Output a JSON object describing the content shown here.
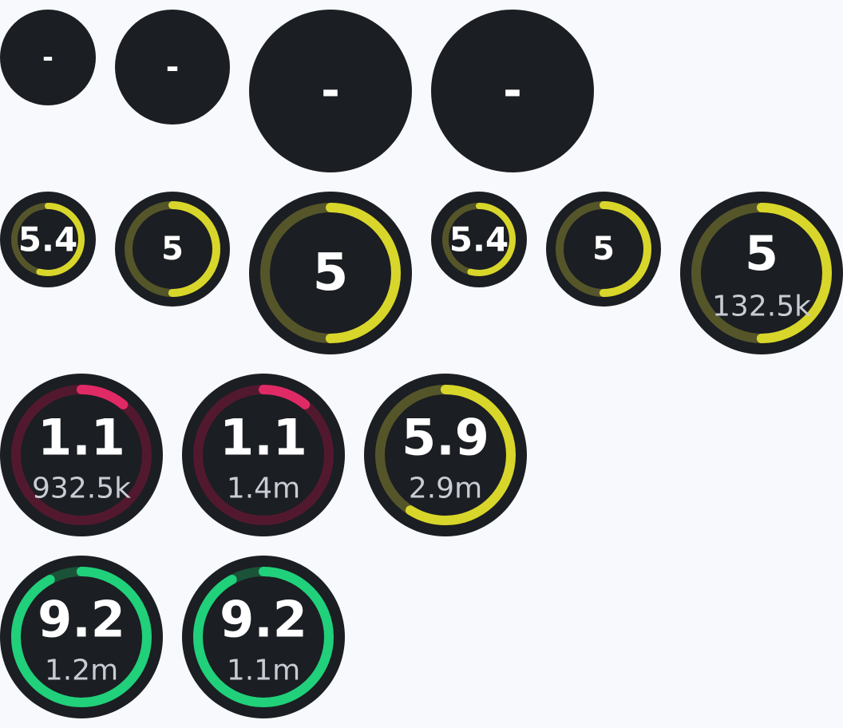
{
  "colors": {
    "page_bg": "#f7f9fd",
    "badge_bg": "#1b1e22",
    "yellow": "#d8d62a",
    "yellow_track": "#55552a",
    "red": "#e02a66",
    "red_track": "#52192e",
    "green": "#21d07a",
    "green_track": "#1a5338",
    "count_text": "#c8ccd4"
  },
  "badges": [
    {
      "id": "empty-1",
      "score": "-",
      "progress": null
    },
    {
      "id": "empty-2",
      "score": "-",
      "progress": null
    },
    {
      "id": "empty-3",
      "score": "-",
      "progress": null
    },
    {
      "id": "empty-4",
      "score": "-",
      "progress": null
    },
    {
      "id": "rating-5-4-a",
      "score": "5.4",
      "progress": 0.54,
      "color": "yellow"
    },
    {
      "id": "rating-5-a",
      "score": "5",
      "progress": 0.5,
      "color": "yellow"
    },
    {
      "id": "rating-5-b",
      "score": "5",
      "progress": 0.5,
      "color": "yellow"
    },
    {
      "id": "rating-5-4-b",
      "score": "5.4",
      "progress": 0.54,
      "color": "yellow"
    },
    {
      "id": "rating-5-c",
      "score": "5",
      "progress": 0.5,
      "color": "yellow"
    },
    {
      "id": "rating-5-votes",
      "score": "5",
      "count": "132.5k",
      "progress": 0.5,
      "color": "yellow"
    },
    {
      "id": "rating-1-1-a",
      "score": "1.1",
      "count": "932.5k",
      "progress": 0.11,
      "color": "red"
    },
    {
      "id": "rating-1-1-b",
      "score": "1.1",
      "count": "1.4m",
      "progress": 0.11,
      "color": "red"
    },
    {
      "id": "rating-5-9",
      "score": "5.9",
      "count": "2.9m",
      "progress": 0.59,
      "color": "yellow"
    },
    {
      "id": "rating-9-2-a",
      "score": "9.2",
      "count": "1.2m",
      "progress": 0.92,
      "color": "green"
    },
    {
      "id": "rating-9-2-b",
      "score": "9.2",
      "count": "1.1m",
      "progress": 0.92,
      "color": "green"
    }
  ]
}
